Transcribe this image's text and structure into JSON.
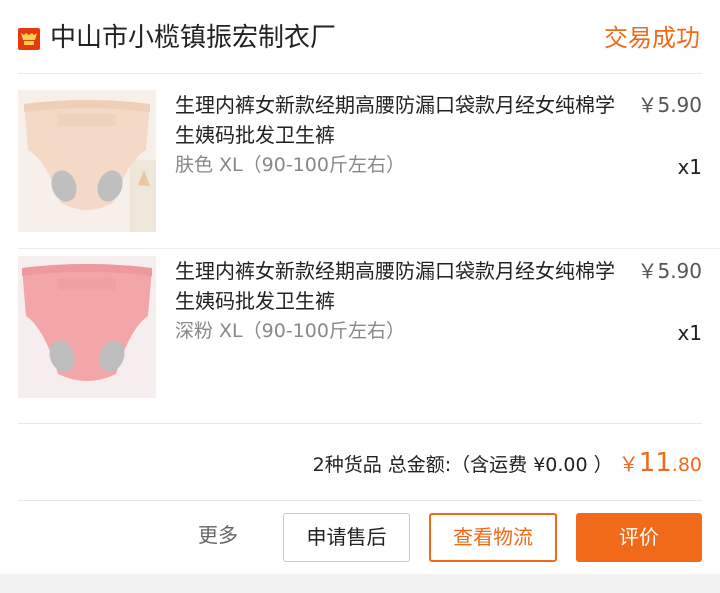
{
  "store": {
    "name": "中山市小榄镇振宏制衣厂",
    "status": "交易成功"
  },
  "items": [
    {
      "title": "生理内裤女新款经期高腰防漏口袋款月经女纯棉学生姨码批发卫生裤",
      "variant": "肤色 XL（90-100斤左右）",
      "price": "￥5.90",
      "qty": "x1",
      "color": "#f3d9c6"
    },
    {
      "title": "生理内裤女新款经期高腰防漏口袋款月经女纯棉学生姨码批发卫生裤",
      "variant": "深粉 XL（90-100斤左右）",
      "price": "￥5.90",
      "qty": "x1",
      "color": "#f2a6a8"
    }
  ],
  "summary": {
    "prefix": "2种货品 总金额:（含运费 ¥0.00 ）",
    "currency": "￥",
    "amount_int": "11",
    "amount_dec": ".80"
  },
  "actions": {
    "more": "更多",
    "after_sale": "申请售后",
    "logistics": "查看物流",
    "review": "评价"
  },
  "colors": {
    "accent": "#f06a19",
    "store_icon": "#e8380d"
  }
}
